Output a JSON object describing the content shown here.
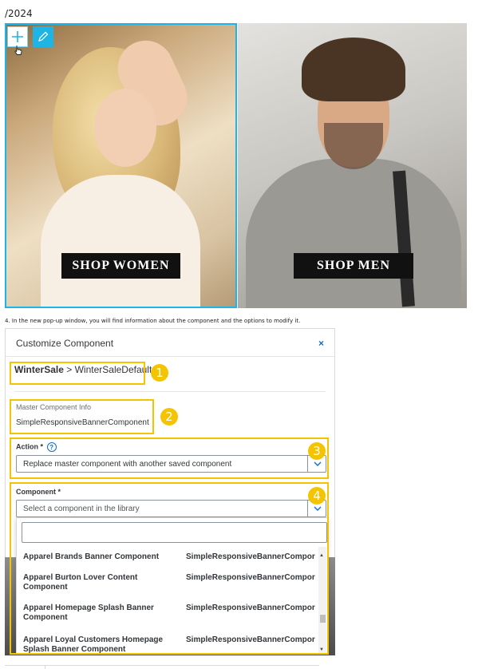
{
  "page_date": "/2024",
  "banners": {
    "women_label": "SHOP WOMEN",
    "men_label": "SHOP MEN",
    "selection_color": "#1fb4e6"
  },
  "caption": "4. In the new pop-up window, you will find information about the component and the options to modify it.",
  "dialog": {
    "title": "Customize Component",
    "close_glyph": "×",
    "breadcrumb_bold": "WinterSale",
    "breadcrumb_rest": " > WinterSaleDefault",
    "master_info_label": "Master Component Info",
    "master_info_value": "SimpleResponsiveBannerComponent",
    "action_label": "Action *",
    "action_help_glyph": "?",
    "action_value": "Replace master component with another saved component",
    "component_label": "Component *",
    "component_placeholder": "Select a component in the library",
    "dropdown_items": [
      {
        "name": "Apparel Brands Banner Component",
        "type": "SimpleResponsiveBannerCompor"
      },
      {
        "name": "Apparel Burton Lover Content Component",
        "type": "SimpleResponsiveBannerCompor"
      },
      {
        "name": "Apparel Homepage Splash Banner Component",
        "type": "SimpleResponsiveBannerCompor"
      },
      {
        "name": "Apparel Loyal Customers Homepage Splash Banner Component",
        "type": "SimpleResponsiveBannerCompor"
      }
    ]
  },
  "callouts": [
    "1",
    "2",
    "3",
    "4"
  ],
  "colors": {
    "accent": "#0a6ed1",
    "callout": "#f5c400"
  }
}
